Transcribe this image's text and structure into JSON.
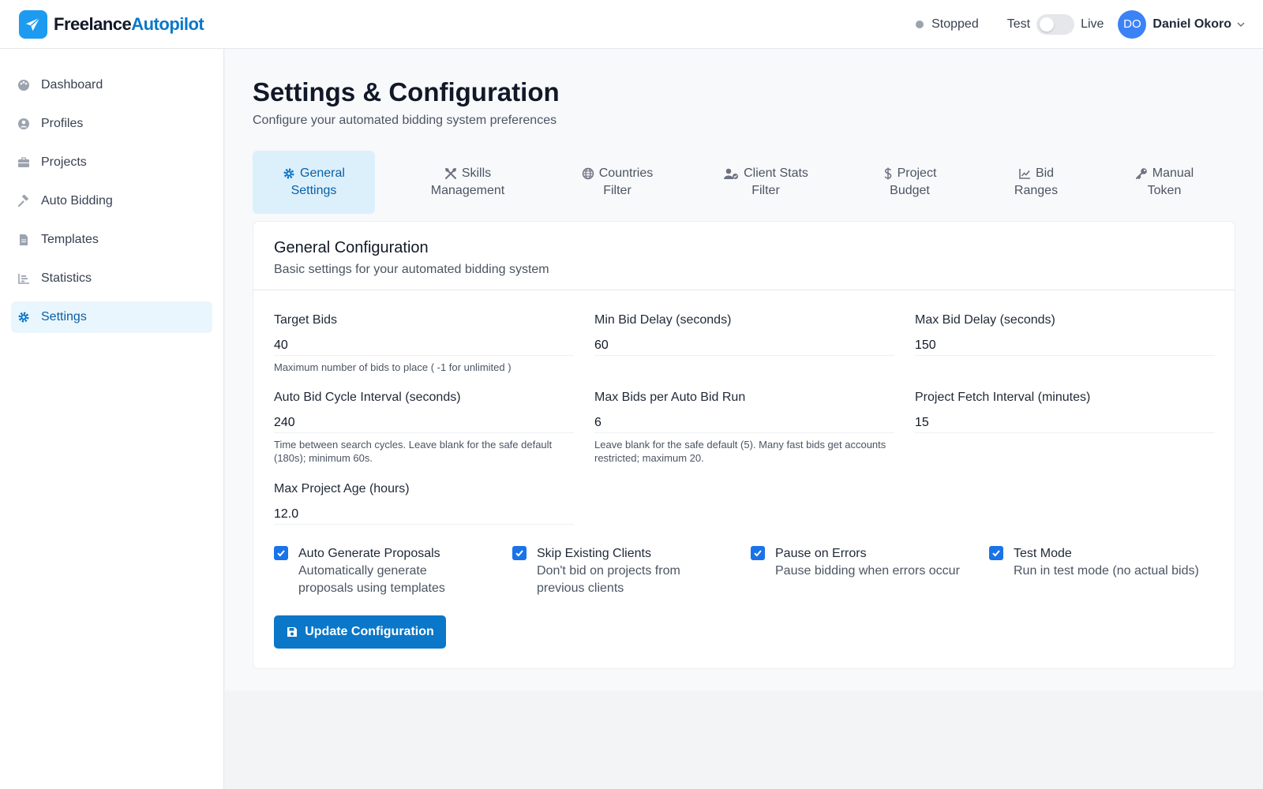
{
  "brand": {
    "name_a": "Freelance",
    "name_b": "Autopilot"
  },
  "topbar": {
    "status": "Stopped",
    "mode_left": "Test",
    "mode_right": "Live",
    "avatar_initials": "DO",
    "user_name": "Daniel Okoro"
  },
  "sidebar": {
    "items": [
      {
        "label": "Dashboard",
        "icon": "palette-icon"
      },
      {
        "label": "Profiles",
        "icon": "user-circle-icon"
      },
      {
        "label": "Projects",
        "icon": "briefcase-icon"
      },
      {
        "label": "Auto Bidding",
        "icon": "gavel-icon"
      },
      {
        "label": "Templates",
        "icon": "file-icon"
      },
      {
        "label": "Statistics",
        "icon": "bar-chart-icon"
      },
      {
        "label": "Settings",
        "icon": "gear-icon",
        "active": true
      }
    ]
  },
  "page": {
    "title": "Settings & Configuration",
    "subtitle": "Configure your automated bidding system preferences"
  },
  "tabs": [
    {
      "line1": "General",
      "line2": "Settings",
      "icon": "gear-icon",
      "active": true
    },
    {
      "line1": "Skills",
      "line2": "Management",
      "icon": "tools-icon"
    },
    {
      "line1": "Countries",
      "line2": "Filter",
      "icon": "globe-icon"
    },
    {
      "line1": "Client Stats",
      "line2": "Filter",
      "icon": "user-check-icon"
    },
    {
      "line1": "Project",
      "line2": "Budget",
      "icon": "dollar-icon"
    },
    {
      "line1": "Bid",
      "line2": "Ranges",
      "icon": "line-chart-icon"
    },
    {
      "line1": "Manual",
      "line2": "Token",
      "icon": "key-icon"
    }
  ],
  "card": {
    "title": "General Configuration",
    "subtitle": "Basic settings for your automated bidding system"
  },
  "fields": {
    "target_bids": {
      "label": "Target Bids",
      "value": "40",
      "help": "Maximum number of bids to place ( -1 for unlimited )"
    },
    "min_bid_delay": {
      "label": "Min Bid Delay (seconds)",
      "value": "60"
    },
    "max_bid_delay": {
      "label": "Max Bid Delay (seconds)",
      "value": "150"
    },
    "auto_bid_cycle": {
      "label": "Auto Bid Cycle Interval (seconds)",
      "value": "240",
      "help": "Time between search cycles. Leave blank for the safe default (180s); minimum 60s."
    },
    "max_bids_per_run": {
      "label": "Max Bids per Auto Bid Run",
      "value": "6",
      "help": "Leave blank for the safe default (5). Many fast bids get accounts restricted; maximum 20."
    },
    "project_fetch_interval": {
      "label": "Project Fetch Interval (minutes)",
      "value": "15"
    },
    "max_project_age": {
      "label": "Max Project Age (hours)",
      "value": "12.0"
    }
  },
  "checks": [
    {
      "title": "Auto Generate Proposals",
      "desc": "Automatically generate proposals using templates",
      "checked": true
    },
    {
      "title": "Skip Existing Clients",
      "desc": "Don't bid on projects from previous clients",
      "checked": true
    },
    {
      "title": "Pause on Errors",
      "desc": "Pause bidding when errors occur",
      "checked": true
    },
    {
      "title": "Test Mode",
      "desc": "Run in test mode (no actual bids)",
      "checked": true
    }
  ],
  "actions": {
    "update_label": "Update Configuration"
  },
  "colors": {
    "accent": "#0b77c8",
    "active_tab_bg": "#dcf0fc",
    "active_nav_bg": "#eaf6fd",
    "checkbox": "#1a73e8",
    "status_dot": "#9ca3af"
  }
}
